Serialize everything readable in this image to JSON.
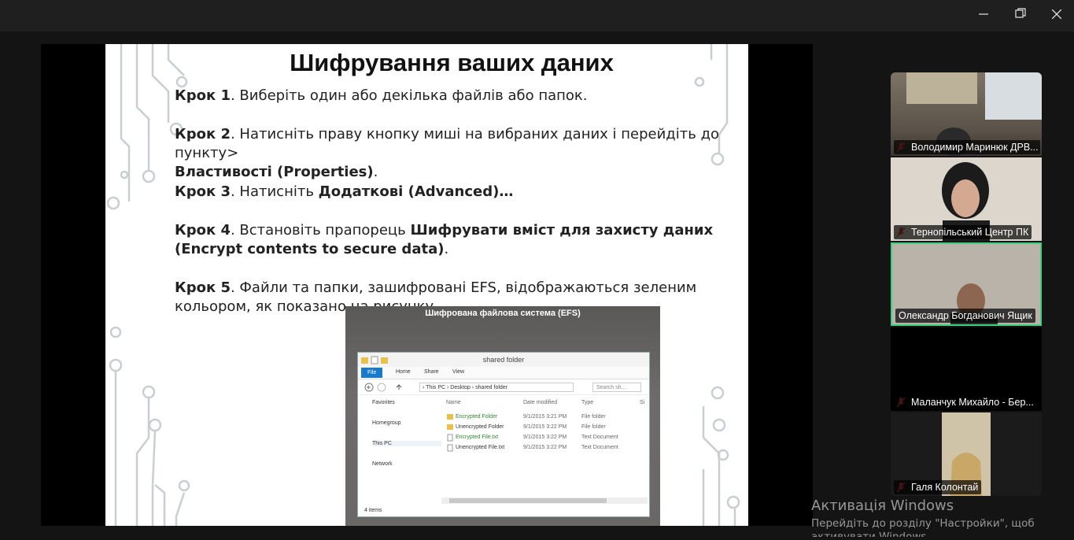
{
  "window": {
    "minimize_icon": "minimize-icon",
    "restore_icon": "restore-icon",
    "close_icon": "close-icon"
  },
  "slide": {
    "title": "Шифрування ваших даних",
    "steps": [
      {
        "label": "Крок 1",
        "text": ". Виберіть один або декілька файлів або папок."
      },
      {
        "label": "Крок 2",
        "text": ". Натисніть праву кнопку миші на вибраних даних і перейдіть до пункту>",
        "bold2": "Властивості (Properties)",
        "text2": "."
      },
      {
        "label": "Крок 3",
        "text": ". Натисніть ",
        "bold2": "Додаткові (Advanced)…",
        "text2": ""
      },
      {
        "label": "Крок 4",
        "text": ". Встановіть прапорець ",
        "bold2": "Шифрувати вміст для захисту даних (Encrypt contents to secure data)",
        "text2": "."
      },
      {
        "label": "Крок 5",
        "text": ". Файли та папки, зашифровані EFS, відображаються зеленим кольором, як показано на рисунку."
      }
    ],
    "figure": {
      "caption": "Шифрована файлова система (EFS)",
      "window_title": "shared folder",
      "ribbon_tabs": [
        "File",
        "Home",
        "Share",
        "View"
      ],
      "address_path": "›  This PC  ›  Desktop  ›  shared folder",
      "search_placeholder": "Search sh...",
      "nav_items": [
        "Favorites",
        "Homegroup",
        "This PC",
        "Network"
      ],
      "columns": [
        "Name",
        "Date modified",
        "Type",
        "Si"
      ],
      "rows": [
        {
          "name": "Encrypted Folder",
          "date": "9/1/2015 3:21 PM",
          "type": "File folder",
          "encrypted": true
        },
        {
          "name": "Unencrypted Folder",
          "date": "9/1/2015 3:22 PM",
          "type": "File folder",
          "encrypted": false
        },
        {
          "name": "Encrypted File.txt",
          "date": "9/1/2015 3:22 PM",
          "type": "Text Document",
          "encrypted": true
        },
        {
          "name": "Unencrypted File.txt",
          "date": "9/1/2015 3:22 PM",
          "type": "Text Document",
          "encrypted": false
        }
      ],
      "status": "4 items"
    }
  },
  "participants": [
    {
      "name": "Володимир Маринюк ДРВ...",
      "muted": true,
      "bg": "#6b6459"
    },
    {
      "name": "Тернопільський Центр ПК",
      "muted": true,
      "bg": "#d9d3ca"
    },
    {
      "name": "Олександр Богданович Ящик",
      "muted": false,
      "bg": "#b6b0a7",
      "active": true
    },
    {
      "name": "Маланчук Михайло - Бер...",
      "muted": true,
      "bg": "#000000"
    },
    {
      "name": "Галя Колонтай",
      "muted": true,
      "bg": "#1a1a1a"
    }
  ],
  "activation": {
    "title": "Активація Windows",
    "subtitle": "Перейдіть до розділу \"Настройки\", щоб",
    "subtitle2": "активувати Windows."
  },
  "colors": {
    "active_speaker_border": "#3fd17f",
    "muted_mic": "#e0433b",
    "encrypted_green": "#2e8b2e"
  }
}
